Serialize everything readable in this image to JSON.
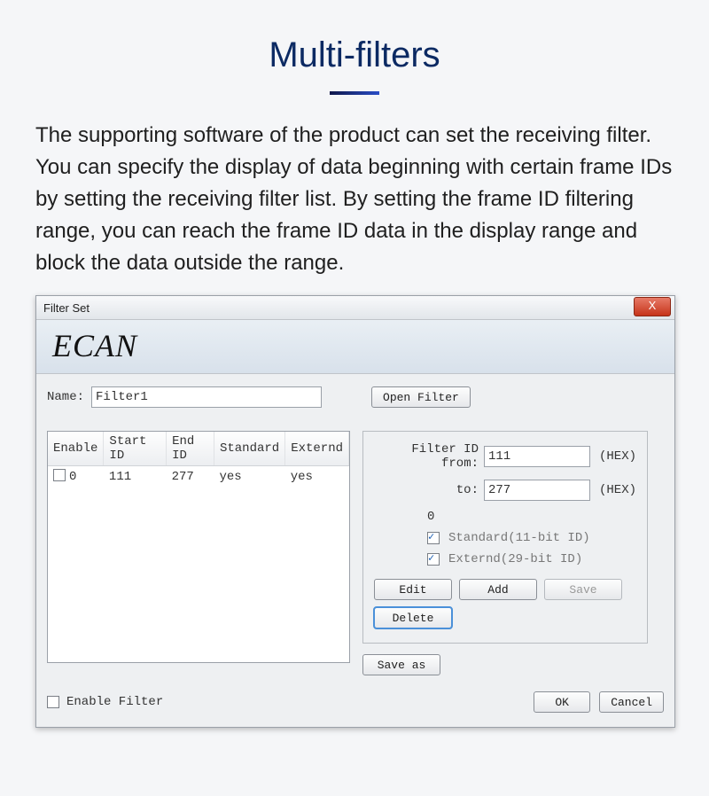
{
  "doc": {
    "title": "Multi-filters",
    "body": "The supporting software of the product can set the receiving filter. You can specify the display of data beginning with certain frame IDs by setting the receiving filter list. By setting the frame ID filtering range, you can reach the frame ID data in the display range and block the data outside the range."
  },
  "dialog": {
    "title": "Filter Set",
    "close_glyph": "X",
    "brand": "ECAN",
    "name_label": "Name:",
    "name_value": "Filter1",
    "open_filter_label": "Open Filter",
    "table": {
      "columns": [
        "Enable",
        "Start ID",
        "End ID",
        "Standard",
        "Externd"
      ],
      "rows": [
        {
          "enable_checked": false,
          "enable_text": "0",
          "start_id": "111",
          "end_id": "277",
          "standard": "yes",
          "externd": "yes"
        }
      ]
    },
    "right": {
      "from_label": "Filter ID from:",
      "from_value": "111",
      "to_label": "to:",
      "to_value": "277",
      "hex_suffix": "(HEX)",
      "zero_line": "0",
      "std_checked": true,
      "std_label": "Standard(11-bit ID)",
      "ext_checked": true,
      "ext_label": "Externd(29-bit ID)",
      "edit_label": "Edit",
      "add_label": "Add",
      "save_label": "Save",
      "delete_label": "Delete"
    },
    "save_as_label": "Save as",
    "bottom": {
      "enable_filter_checked": false,
      "enable_filter_label": "Enable Filter",
      "ok_label": "OK",
      "cancel_label": "Cancel"
    }
  }
}
